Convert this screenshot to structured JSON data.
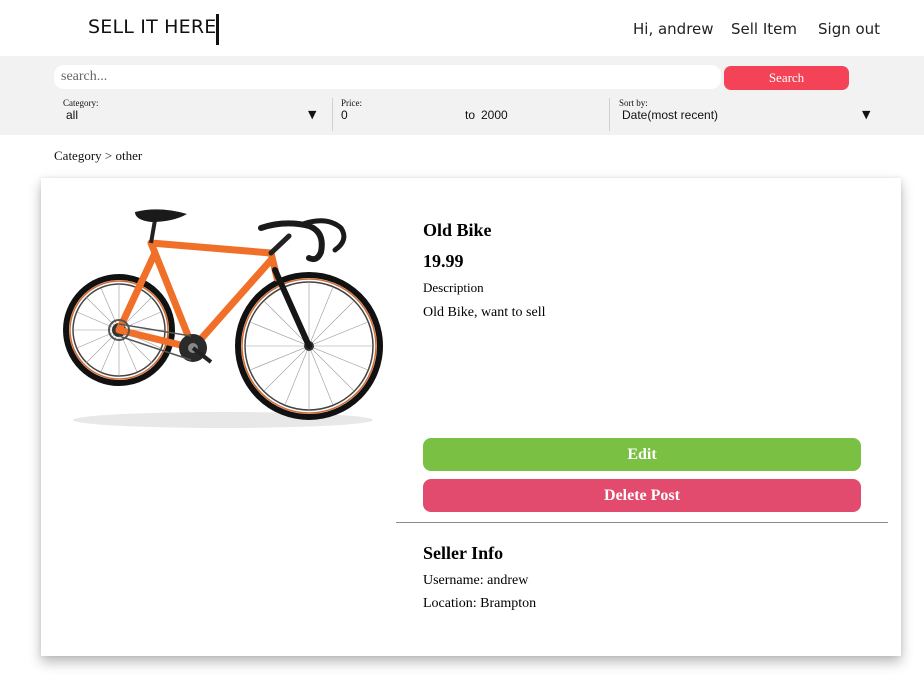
{
  "header": {
    "brand": "SELL IT HERE",
    "greeting": "Hi, andrew",
    "sell_item": "Sell Item",
    "sign_out": "Sign out"
  },
  "search": {
    "placeholder": "search...",
    "button_label": "Search"
  },
  "filters": {
    "category": {
      "label": "Category:",
      "value": "all"
    },
    "price": {
      "label": "Price:",
      "min": "0",
      "to": "to",
      "max": "2000"
    },
    "sort": {
      "label": "Sort by:",
      "value": "Date(most recent)"
    },
    "caret": "▼"
  },
  "breadcrumb": "Category > other",
  "product": {
    "image_icon": "bicycle-image",
    "title": "Old Bike",
    "price": "19.99",
    "description_label": "Description",
    "description": "Old Bike, want to sell",
    "edit_label": "Edit",
    "delete_label": "Delete Post"
  },
  "seller": {
    "title": "Seller Info",
    "username_line": "Username: andrew",
    "location_line": "Location: Brampton"
  },
  "colors": {
    "search_button": "#f44257",
    "edit_button": "#7ac143",
    "delete_button": "#e24a6e",
    "bike_frame": "#f0702a"
  }
}
